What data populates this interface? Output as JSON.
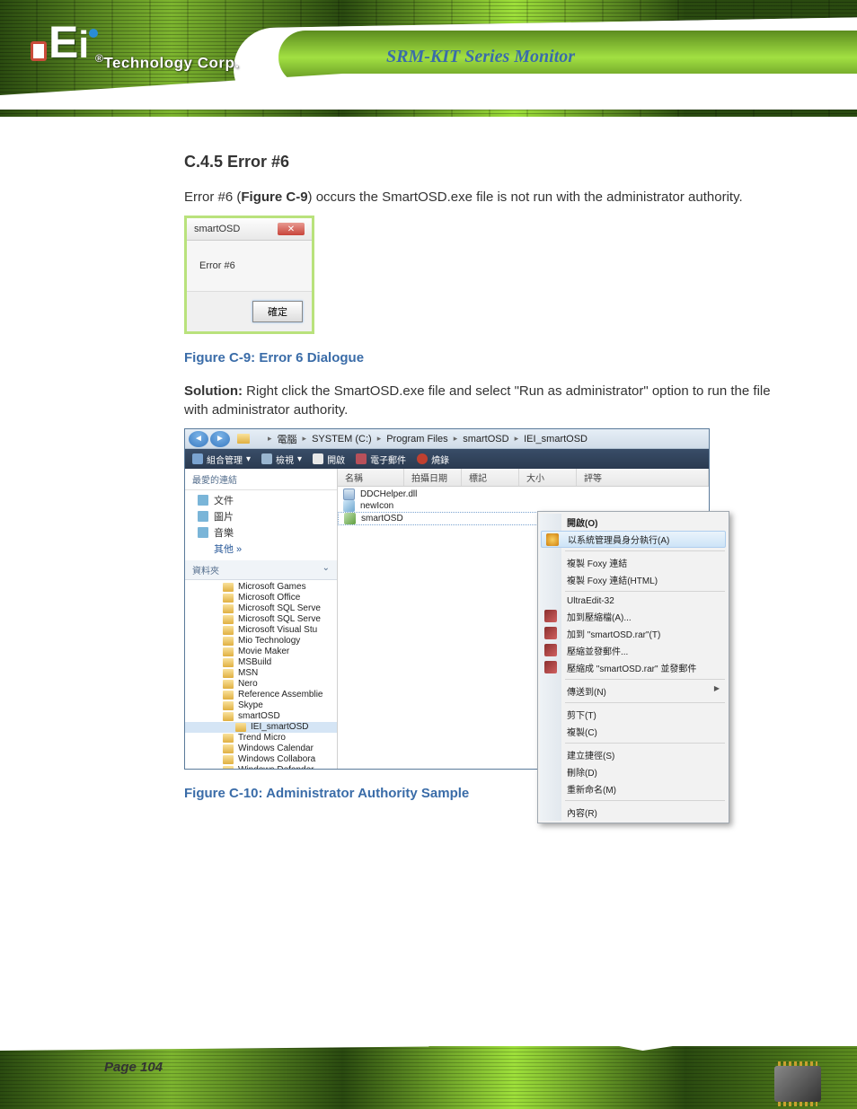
{
  "header": {
    "brand_text": "Technology Corp.",
    "reg_symbol": "®"
  },
  "product_title": "SRM-KIT Series Monitor",
  "section_heading": "C.4.5 Error #6",
  "error_lead": "Error #6 (",
  "error_fig_ref": "Figure C-9",
  "error_tail": ") occurs the SmartOSD.exe file is not run with the administrator authority.",
  "error_dialog": {
    "title": "smartOSD",
    "message": "Error #6",
    "ok": "確定"
  },
  "figure_caption_1": "Figure C-9: Error 6 Dialogue",
  "solution_label": "Solution:",
  "solution_text": " Right click the SmartOSD.exe file and select \"Run as administrator\" option to run the file with administrator authority.",
  "explorer": {
    "breadcrumb": [
      "電腦",
      "SYSTEM (C:)",
      "Program Files",
      "smartOSD",
      "IEI_smartOSD"
    ],
    "toolbar": [
      "組合管理",
      "檢視",
      "開啟",
      "電子郵件",
      "燒錄"
    ],
    "fav_label": "最愛的連結",
    "favs": [
      "文件",
      "圖片",
      "音樂",
      "其他 »"
    ],
    "section_label": "資料夾",
    "tree": [
      "Microsoft Games",
      "Microsoft Office",
      "Microsoft SQL Serve",
      "Microsoft SQL Serve",
      "Microsoft Visual Stu",
      "Mio Technology",
      "Movie Maker",
      "MSBuild",
      "MSN",
      "Nero",
      "Reference Assemblie",
      "Skype",
      "smartOSD",
      "IEI_smartOSD",
      "Trend Micro",
      "Windows Calendar",
      "Windows Collabora",
      "Windows Defender"
    ],
    "columns": [
      "名稱",
      "拍攝日期",
      "標記",
      "大小",
      "評等"
    ],
    "files": [
      {
        "name": "DDCHelper.dll",
        "type": "dll"
      },
      {
        "name": "newIcon",
        "type": "ico"
      },
      {
        "name": "smartOSD",
        "type": "exe"
      }
    ]
  },
  "context_menu": {
    "open": "開啟(O)",
    "runas": "以系統管理員身分執行(A)",
    "foxy1": "複製 Foxy 連結",
    "foxy2": "複製 Foxy 連結(HTML)",
    "ultra": "UltraEdit-32",
    "rar1": "加到壓縮檔(A)...",
    "rar2": "加到 \"smartOSD.rar\"(T)",
    "rar3": "壓縮並發郵件...",
    "rar4": "壓縮成 \"smartOSD.rar\" 並發郵件",
    "send": "傳送到(N)",
    "cut": "剪下(T)",
    "copy": "複製(C)",
    "shortcut": "建立捷徑(S)",
    "delete": "刪除(D)",
    "rename": "重新命名(M)",
    "props": "內容(R)"
  },
  "figure_caption_2": "Figure C-10: Administrator Authority Sample",
  "page_number": "Page 104"
}
